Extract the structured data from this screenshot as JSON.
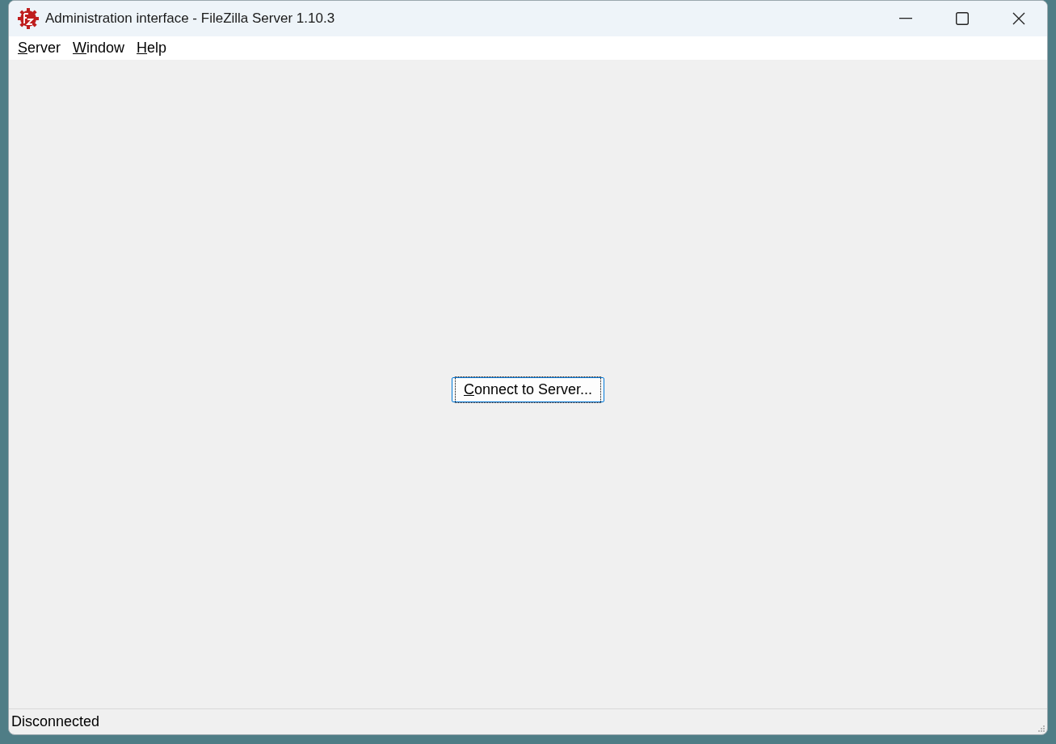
{
  "window": {
    "title": "Administration interface - FileZilla Server 1.10.3"
  },
  "menu": [
    "Server",
    "Window",
    "Help"
  ],
  "connect_button": {
    "label": "Connect to Server...",
    "focused": true
  },
  "status_bar": {
    "text": "Disconnected"
  }
}
